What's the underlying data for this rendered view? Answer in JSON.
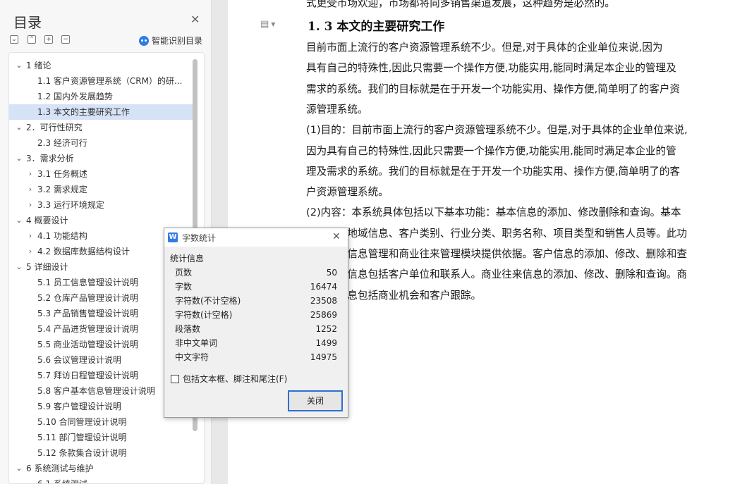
{
  "toc": {
    "title": "目录",
    "smart_recognize": "智能识别目录",
    "items": [
      {
        "label": "1 绪论",
        "expanded": true,
        "level": 0
      },
      {
        "label": "1.1 客户资源管理系统（CRM）的研...",
        "level": 1
      },
      {
        "label": "1.2 国内外发展趋势",
        "level": 1
      },
      {
        "label": "1.3 本文的主要研究工作",
        "level": 1,
        "selected": true
      },
      {
        "label": "2．可行性研究",
        "expanded": true,
        "level": 0
      },
      {
        "label": "2.3 经济可行",
        "level": 1
      },
      {
        "label": "3．需求分析",
        "expanded": true,
        "level": 0
      },
      {
        "label": "3.1  任务概述",
        "collapsed": true,
        "level": 1
      },
      {
        "label": "3.2 需求规定",
        "collapsed": true,
        "level": 1
      },
      {
        "label": "3.3 运行环境规定",
        "collapsed": true,
        "level": 1
      },
      {
        "label": "4  概要设计",
        "expanded": true,
        "level": 0
      },
      {
        "label": "4.1  功能结构",
        "collapsed": true,
        "level": 1
      },
      {
        "label": "4.2  数据库数据结构设计",
        "collapsed": true,
        "level": 1
      },
      {
        "label": "5  详细设计",
        "expanded": true,
        "level": 0
      },
      {
        "label": "5.1    员工信息管理设计说明",
        "level": 1
      },
      {
        "label": "5.2 仓库产品管理设计说明",
        "level": 1
      },
      {
        "label": "5.3  产品销售管理设计说明",
        "level": 1
      },
      {
        "label": "5.4  产品进货管理设计说明",
        "level": 1
      },
      {
        "label": "5.5  商业活动管理设计说明",
        "level": 1
      },
      {
        "label": "5.6  会议管理设计说明",
        "level": 1
      },
      {
        "label": "5.7  拜访日程管理设计说明",
        "level": 1
      },
      {
        "label": "5.8  客户基本信息管理设计说明",
        "level": 1
      },
      {
        "label": "5.9  客户管理设计说明",
        "level": 1
      },
      {
        "label": "5.10  合同管理设计说明",
        "level": 1
      },
      {
        "label": "5.11  部门管理设计说明",
        "level": 1
      },
      {
        "label": "5.12  条款集合设计说明",
        "level": 1
      },
      {
        "label": "6  系统测试与维护",
        "expanded": true,
        "level": 0
      },
      {
        "label": "6.1  系统测试",
        "level": 1
      }
    ]
  },
  "document": {
    "top_cut_line": "式更受市场欢迎，市场都将向多销售渠道发展，这种趋势是必然的。",
    "heading": "1. 3 本文的主要研究工作",
    "lines": [
      "        目前市面上流行的客户资源管理系统不少。但是,对于具体的企业单位来说,因为",
      "具有自己的特殊性,因此只需要一个操作方便,功能实用,能同时满足本企业的管理及",
      "需求的系统。我们的目标就是在于开发一个功能实用、操作方便,简单明了的客户资",
      "源管理系统。",
      "(1)目的：目前市面上流行的客户资源管理系统不少。但是,对于具体的企业单位来说,",
      "因为具有自己的特殊性,因此只需要一个操作方便,功能实用,能同时满足本企业的管",
      "理及需求的系统。我们的目标就是在于开发一个功能实用、操作方便,简单明了的客",
      "户资源管理系统。",
      "(2)内容：本系统具体包括以下基本功能：基本信息的添加、修改删除和查询。基本",
      "信息包括地域信息、客户类别、行业分类、职务名称、项目类型和销售人员等。此功",
      "能为客户信息管理和商业往来管理模块提供依据。客户信息的添加、修改、删除和查",
      "询。客户信息包括客户单位和联系人。商业往来信息的添加、修改、删除和查询。商",
      "业往来信息包括商业机会和客户跟踪。"
    ]
  },
  "dialog": {
    "title": "字数统计",
    "section": "统计信息",
    "stats": [
      {
        "label": "页数",
        "value": "50"
      },
      {
        "label": "字数",
        "value": "16474"
      },
      {
        "label": "字符数(不计空格)",
        "value": "23508"
      },
      {
        "label": "字符数(计空格)",
        "value": "25869"
      },
      {
        "label": "段落数",
        "value": "1252"
      },
      {
        "label": "非中文单词",
        "value": "1499"
      },
      {
        "label": "中文字符",
        "value": "14975"
      }
    ],
    "checkbox_label": "包括文本框、脚注和尾注(F)",
    "close_button": "关闭"
  },
  "colors": {
    "accent": "#2f7ce5",
    "selection": "#d6e2f6"
  }
}
